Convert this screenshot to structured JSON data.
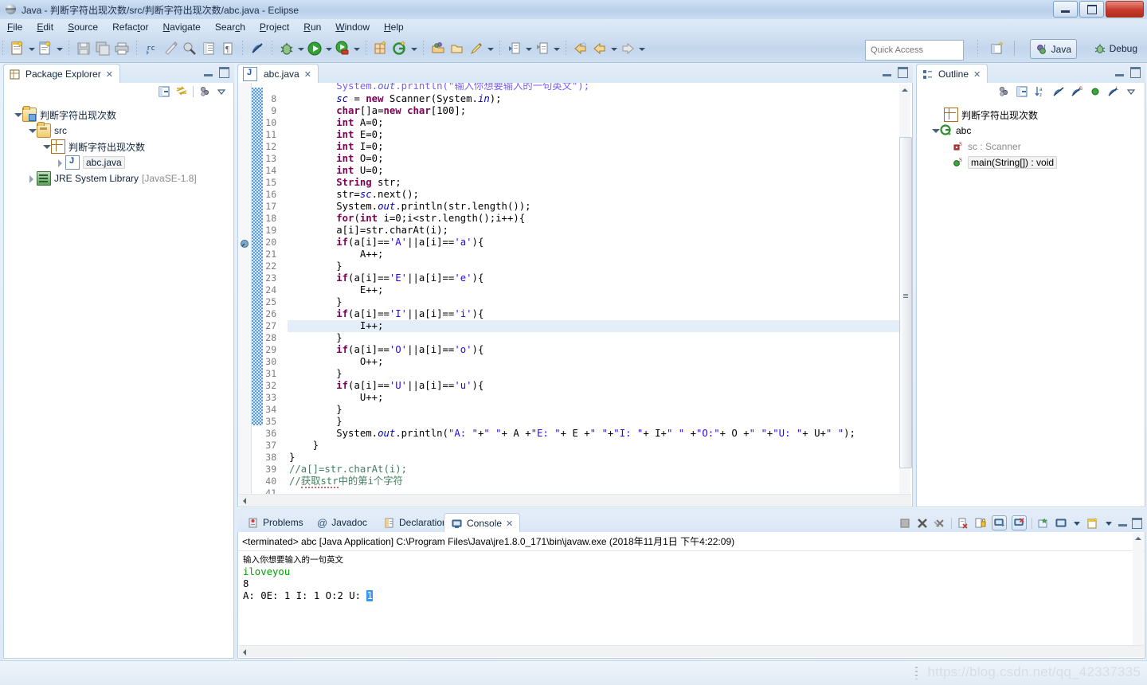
{
  "window": {
    "title": "Java - 判断字符出现次数/src/判断字符出现次数/abc.java - Eclipse",
    "app_icon": "eclipse-icon",
    "minimize_label": "Minimize",
    "restore_label": "Restore",
    "close_label": "✕"
  },
  "menu": [
    {
      "label": "File",
      "accel": "F"
    },
    {
      "label": "Edit",
      "accel": "E"
    },
    {
      "label": "Source",
      "accel": "S"
    },
    {
      "label": "Refactor",
      "accel": "t"
    },
    {
      "label": "Navigate",
      "accel": "N"
    },
    {
      "label": "Search",
      "accel": "c"
    },
    {
      "label": "Project",
      "accel": "P"
    },
    {
      "label": "Run",
      "accel": "R"
    },
    {
      "label": "Window",
      "accel": "W"
    },
    {
      "label": "Help",
      "accel": "H"
    }
  ],
  "toolbar": {
    "quick_access_placeholder": "Quick Access",
    "perspective_java": "Java",
    "perspective_debug": "Debug",
    "icons": [
      "new-wizard-icon",
      "new-java-class-icon",
      "save-icon",
      "save-all-icon",
      "print-icon",
      "toggle-mark-occurrences-icon",
      "new-java-package-icon",
      "external-tools-icon",
      "open-task-icon",
      "open-type-icon",
      "skip-breakpoints-icon",
      "debug-icon",
      "run-icon",
      "run-coverage-icon",
      "new-java-project-icon",
      "new-annotation-icon",
      "open-type-hierarchy-icon",
      "open-resource-icon",
      "search-icon",
      "previous-annotation-icon",
      "next-annotation-icon",
      "last-edit-location-icon",
      "back-icon",
      "forward-icon",
      "open-perspective-icon"
    ]
  },
  "package_explorer": {
    "title": "Package Explorer",
    "close_glyph": "✕",
    "toolbar_icons": [
      "collapse-all-icon",
      "link-with-editor-icon",
      "view-menu-icon",
      "view-dropdown-icon"
    ],
    "tree": [
      {
        "label": "判断字符出现次数",
        "icon": "project-folder-icon",
        "indent": 0,
        "twisty": "open",
        "selected": false
      },
      {
        "label": "src",
        "icon": "source-folder-icon",
        "indent": 1,
        "twisty": "open",
        "selected": false
      },
      {
        "label": "判断字符出现次数",
        "icon": "package-icon",
        "indent": 2,
        "twisty": "open",
        "selected": false
      },
      {
        "label": "abc.java",
        "icon": "java-file-icon",
        "indent": 3,
        "twisty": "closed",
        "selected": true
      },
      {
        "label": "JRE System Library",
        "suffix": "[JavaSE-1.8]",
        "icon": "jre-library-icon",
        "indent": 1,
        "twisty": "closed",
        "selected": false
      }
    ]
  },
  "editor": {
    "tab_label": "abc.java",
    "tab_icon": "java-file-icon",
    "close_glyph": "✕",
    "minimize_label": "Minimize",
    "maximize_label": "Maximize",
    "highlighted_line": 27,
    "first_visible_line": 8,
    "partial_top_line": "System.out.println(\"输入你想要输入的一句英文\");",
    "lines": [
      {
        "n": 8,
        "text": "        sc = new Scanner(System.in);"
      },
      {
        "n": 9,
        "text": "        char[]a=new char[100];"
      },
      {
        "n": 10,
        "text": "        int A=0;"
      },
      {
        "n": 11,
        "text": "        int E=0;"
      },
      {
        "n": 12,
        "text": "        int I=0;"
      },
      {
        "n": 13,
        "text": "        int O=0;"
      },
      {
        "n": 14,
        "text": "        int U=0;"
      },
      {
        "n": 15,
        "text": "        String str;"
      },
      {
        "n": 16,
        "text": "        str=sc.next();"
      },
      {
        "n": 17,
        "text": "        System.out.println(str.length());"
      },
      {
        "n": 18,
        "text": "        for(int i=0;i<str.length();i++){"
      },
      {
        "n": 19,
        "text": "        a[i]=str.charAt(i);"
      },
      {
        "n": 20,
        "text": "        if(a[i]=='A'||a[i]=='a'){"
      },
      {
        "n": 21,
        "text": "            A++;"
      },
      {
        "n": 22,
        "text": "        }"
      },
      {
        "n": 23,
        "text": "        if(a[i]=='E'||a[i]=='e'){"
      },
      {
        "n": 24,
        "text": "            E++;"
      },
      {
        "n": 25,
        "text": "        }"
      },
      {
        "n": 26,
        "text": "        if(a[i]=='I'||a[i]=='i'){"
      },
      {
        "n": 27,
        "text": "            I++;"
      },
      {
        "n": 28,
        "text": "        }"
      },
      {
        "n": 29,
        "text": "        if(a[i]=='O'||a[i]=='o'){"
      },
      {
        "n": 30,
        "text": "            O++;"
      },
      {
        "n": 31,
        "text": "        }"
      },
      {
        "n": 32,
        "text": "        if(a[i]=='U'||a[i]=='u'){"
      },
      {
        "n": 33,
        "text": "            U++;"
      },
      {
        "n": 34,
        "text": "        }"
      },
      {
        "n": 35,
        "text": "        }"
      },
      {
        "n": 36,
        "text": "        System.out.println(\"A: \"+\" \"+ A +\"E: \"+ E +\" \"+\"I: \"+ I+\" \" +\"O:\"+ O +\" \"+\"U: \"+ U+\" \");"
      },
      {
        "n": 37,
        "text": "    }"
      },
      {
        "n": 38,
        "text": "}"
      },
      {
        "n": 39,
        "text": "//a[]=str.charAt(i);"
      },
      {
        "n": 40,
        "text": "//获取str中的第i个字符"
      },
      {
        "n": 41,
        "text": ""
      }
    ]
  },
  "outline": {
    "title": "Outline",
    "close_glyph": "✕",
    "toolbar_icons": [
      "focus-on-active-task-icon",
      "collapse-all-icon",
      "sort-icon",
      "hide-fields-icon",
      "hide-static-icon",
      "hide-nonpublic-icon",
      "hide-local-types-icon",
      "view-dropdown-icon"
    ],
    "items": [
      {
        "label": "判断字符出现次数",
        "icon": "package-icon",
        "indent": 1,
        "twisty": "none",
        "selected": false
      },
      {
        "label": "abc",
        "icon": "class-icon",
        "indent": 1,
        "twisty": "open",
        "selected": false
      },
      {
        "label": "sc : Scanner",
        "icon": "private-field-icon",
        "badge": "S",
        "indent": 2,
        "twisty": "none",
        "selected": false,
        "dim": true
      },
      {
        "label": "main(String[]) : void",
        "icon": "public-method-icon",
        "badge": "S",
        "indent": 2,
        "twisty": "none",
        "selected": true
      }
    ]
  },
  "console": {
    "tabs": [
      {
        "label": "Problems",
        "icon": "problems-icon",
        "active": false
      },
      {
        "label": "Javadoc",
        "icon": "javadoc-icon",
        "active": false
      },
      {
        "label": "Declaration",
        "icon": "declaration-icon",
        "active": false
      },
      {
        "label": "Console",
        "icon": "console-icon",
        "active": true,
        "close_glyph": "✕"
      }
    ],
    "launch_line": "<terminated> abc [Java Application] C:\\Program Files\\Java\\jre1.8.0_171\\bin\\javaw.exe (2018年11月1日 下午4:22:09)",
    "output": [
      {
        "text": "输入你想要输入的一句英文",
        "style": "prompt-cn"
      },
      {
        "text": "iloveyou",
        "style": "input"
      },
      {
        "text": "8",
        "style": "stdout"
      },
      {
        "text": "A:  0E: 1 I: 1 O:2 U: ",
        "style": "stdout",
        "cursor": "1"
      }
    ],
    "toolbar_icons": [
      "terminate-icon",
      "remove-launch-icon",
      "remove-all-terminated-icon",
      "clear-console-icon",
      "scroll-lock-icon",
      "show-console-on-output-icon",
      "show-console-on-error-icon",
      "pin-console-icon",
      "display-selected-console-icon",
      "display-selected-dropdown-icon",
      "open-console-icon",
      "open-console-dropdown-icon",
      "minimize-icon",
      "maximize-icon"
    ]
  },
  "status_bar": {
    "watermark": "https://blog.csdn.net/qq_42337335"
  }
}
